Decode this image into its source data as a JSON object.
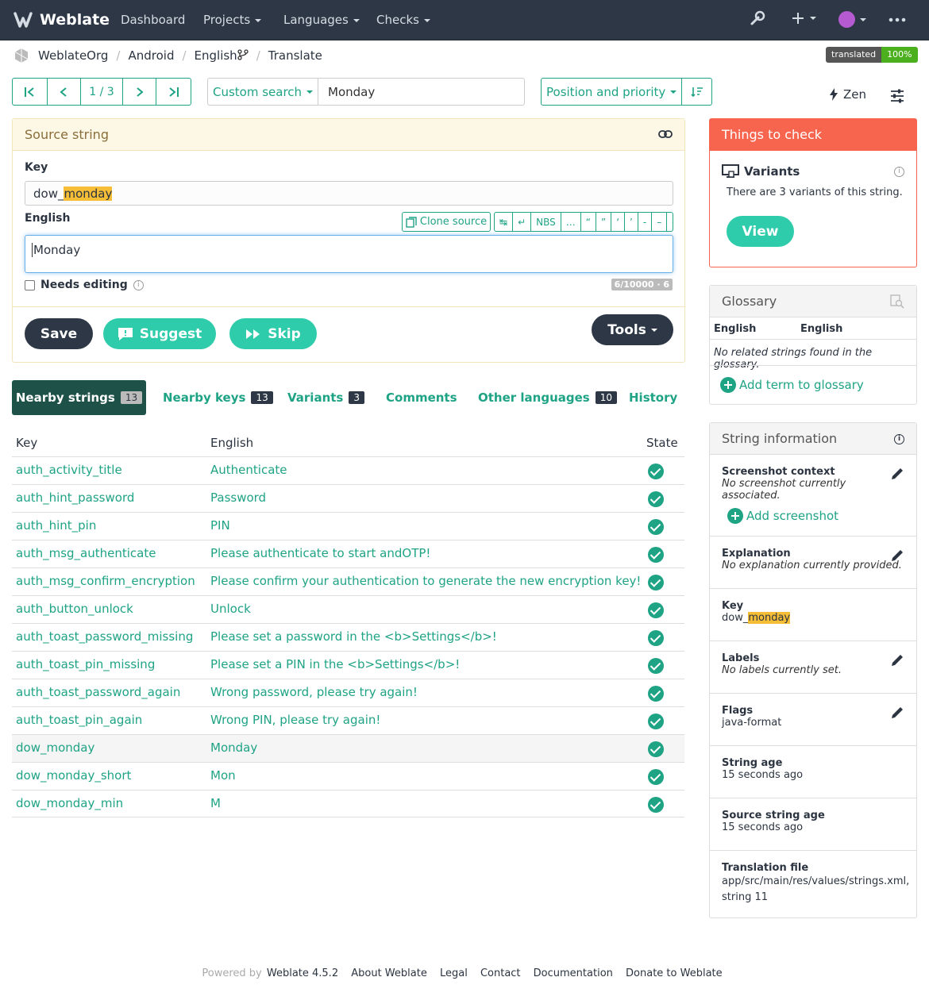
{
  "navbar": {
    "brand": "Weblate",
    "items": [
      "Dashboard",
      "Projects",
      "Languages",
      "Checks"
    ]
  },
  "breadcrumb": [
    "WeblateOrg",
    "Android",
    "English",
    "Translate"
  ],
  "status_badge": {
    "label": "translated",
    "value": "100%"
  },
  "toolbar": {
    "position": "1 / 3",
    "search_mode": "Custom search",
    "search_value": "Monday",
    "sort": "Position and priority",
    "zen": "Zen"
  },
  "source": {
    "title": "Source string",
    "key_label": "Key",
    "key_prefix": "dow_",
    "key_highlight": "monday",
    "lang_label": "English",
    "clone": "Clone source",
    "special_chars": [
      "↹",
      "↵",
      "NBS",
      "…",
      "“",
      "”",
      "‘",
      "’",
      "-",
      "–",
      "—"
    ],
    "text": "Monday",
    "needs_editing": "Needs editing",
    "counter": "6/10000 · 6",
    "save": "Save",
    "suggest": "Suggest",
    "skip": "Skip",
    "tools": "Tools"
  },
  "tabs": [
    {
      "label": "Nearby strings",
      "count": "13"
    },
    {
      "label": "Nearby keys",
      "count": "13"
    },
    {
      "label": "Variants",
      "count": "3"
    },
    {
      "label": "Comments",
      "count": ""
    },
    {
      "label": "Other languages",
      "count": "10"
    },
    {
      "label": "History",
      "count": ""
    }
  ],
  "table": {
    "headers": [
      "Key",
      "English",
      "State"
    ],
    "rows": [
      {
        "key": "auth_activity_title",
        "value": "Authenticate"
      },
      {
        "key": "auth_hint_password",
        "value": "Password"
      },
      {
        "key": "auth_hint_pin",
        "value": "PIN"
      },
      {
        "key": "auth_msg_authenticate",
        "value": "Please authenticate to start andOTP!"
      },
      {
        "key": "auth_msg_confirm_encryption",
        "value": "Please confirm your authentication to generate the new encryption key!"
      },
      {
        "key": "auth_button_unlock",
        "value": "Unlock"
      },
      {
        "key": "auth_toast_password_missing",
        "value": "Please set a password in the <b>Settings</b>!"
      },
      {
        "key": "auth_toast_pin_missing",
        "value": "Please set a PIN in the <b>Settings</b>!"
      },
      {
        "key": "auth_toast_password_again",
        "value": "Wrong password, please try again!"
      },
      {
        "key": "auth_toast_pin_again",
        "value": "Wrong PIN, please try again!"
      },
      {
        "key": "dow_monday",
        "value": "Monday"
      },
      {
        "key": "dow_monday_short",
        "value": "Mon"
      },
      {
        "key": "dow_monday_min",
        "value": "M"
      }
    ]
  },
  "check": {
    "title": "Things to check",
    "name": "Variants",
    "desc": "There are 3 variants of this string.",
    "view": "View"
  },
  "glossary": {
    "title": "Glossary",
    "col1": "English",
    "col2": "English",
    "empty": "No related strings found in the glossary.",
    "add": "Add term to glossary"
  },
  "info": {
    "title": "String information",
    "screenshot_t": "Screenshot context",
    "screenshot_d": "No screenshot currently associated.",
    "add_screenshot": "Add screenshot",
    "explanation_t": "Explanation",
    "explanation_d": "No explanation currently provided.",
    "key_t": "Key",
    "key_prefix": "dow_",
    "key_highlight": "monday",
    "labels_t": "Labels",
    "labels_d": "No labels currently set.",
    "flags_t": "Flags",
    "flags_d": "java-format",
    "age_t": "String age",
    "age_d": "15 seconds ago",
    "src_age_t": "Source string age",
    "src_age_d": "15 seconds ago",
    "file_t": "Translation file",
    "file_d": "app/src/main/res/values/strings.xml, string 11"
  },
  "footer": {
    "powered": "Powered by",
    "links": [
      "Weblate 4.5.2",
      "About Weblate",
      "Legal",
      "Contact",
      "Documentation",
      "Donate to Weblate"
    ]
  }
}
